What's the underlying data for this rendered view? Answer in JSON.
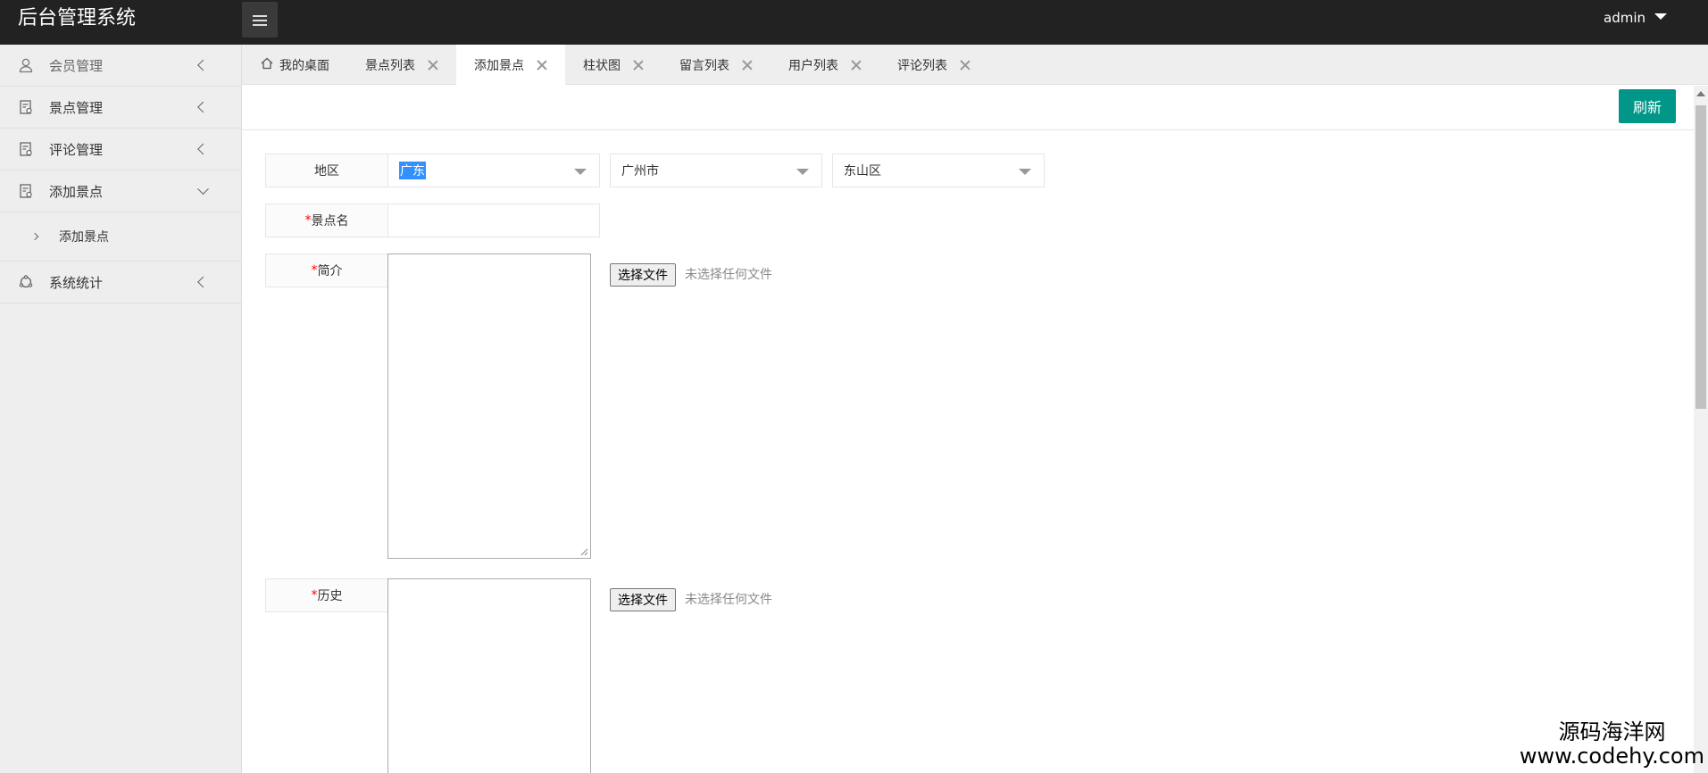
{
  "app": {
    "title": "后台管理系统",
    "user": "admin"
  },
  "sidebar": {
    "items": [
      {
        "label": "会员管理",
        "icon": "user-icon"
      },
      {
        "label": "景点管理",
        "icon": "document-icon"
      },
      {
        "label": "评论管理",
        "icon": "document-icon"
      },
      {
        "label": "添加景点",
        "icon": "document-icon"
      },
      {
        "label": "添加景点",
        "icon": "sub-arrow-icon"
      },
      {
        "label": "系统统计",
        "icon": "stats-icon"
      }
    ]
  },
  "tabs": [
    {
      "label": "我的桌面"
    },
    {
      "label": "景点列表"
    },
    {
      "label": "添加景点"
    },
    {
      "label": "柱状图"
    },
    {
      "label": "留言列表"
    },
    {
      "label": "用户列表"
    },
    {
      "label": "评论列表"
    }
  ],
  "toolbar": {
    "refresh_label": "刷新"
  },
  "form": {
    "region": {
      "label": "地区",
      "province": "广东",
      "city": "广州市",
      "district": "东山区"
    },
    "name": {
      "required": "*",
      "label": "景点名",
      "value": ""
    },
    "intro": {
      "required": "*",
      "label": "简介",
      "value": ""
    },
    "history": {
      "required": "*",
      "label": "历史",
      "value": ""
    },
    "file": {
      "button_label": "选择文件",
      "none_selected": "未选择任何文件"
    }
  },
  "watermark": {
    "line1": "源码海洋网",
    "line2": "www.codehy.com"
  }
}
